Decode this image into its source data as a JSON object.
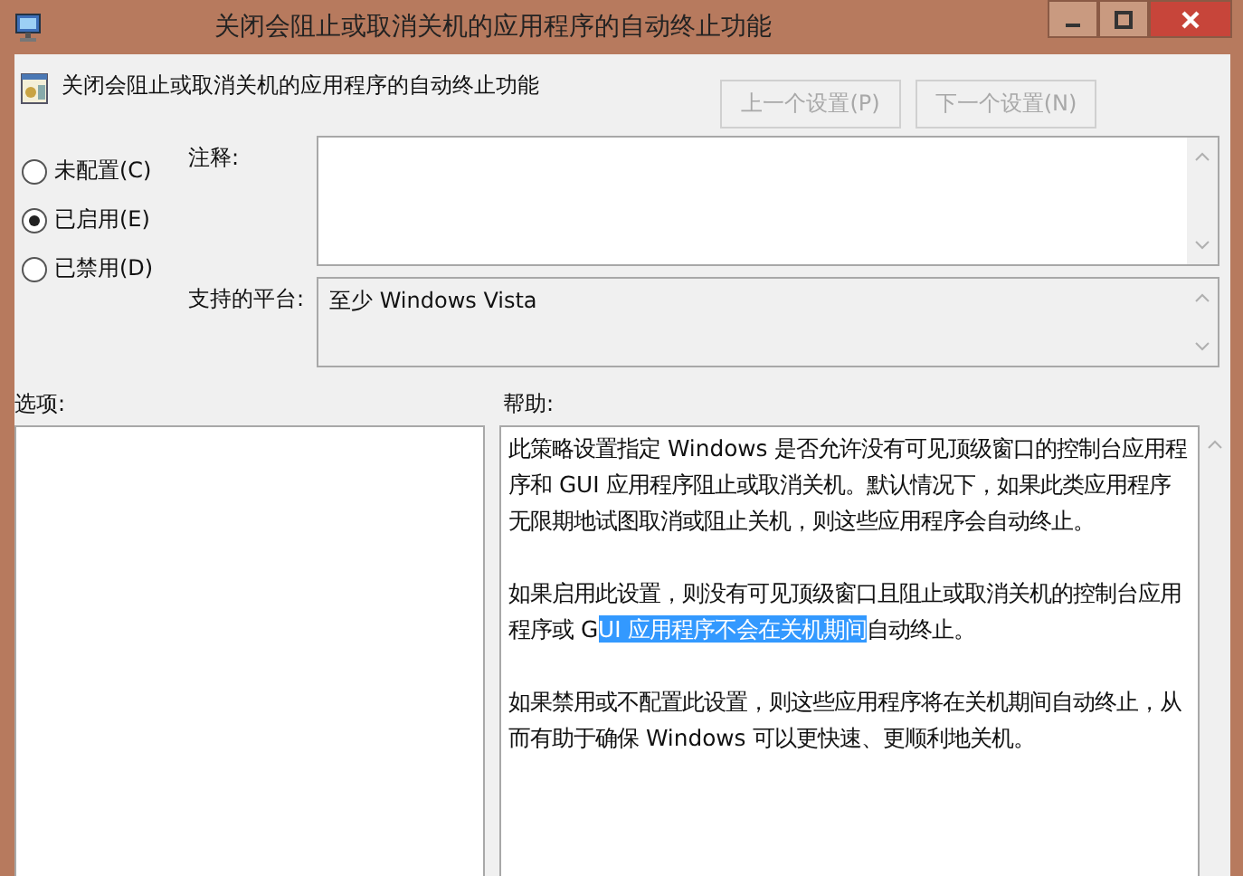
{
  "window": {
    "title": "关闭会阻止或取消关机的应用程序的自动终止功能"
  },
  "header": {
    "title": "关闭会阻止或取消关机的应用程序的自动终止功能"
  },
  "nav_buttons": [
    {
      "label": "上一个设置(P)",
      "disabled": true
    },
    {
      "label": "下一个设置(N)",
      "disabled": true
    }
  ],
  "state_options": [
    {
      "label": "未配置(C)",
      "selected": false
    },
    {
      "label": "已启用(E)",
      "selected": true
    },
    {
      "label": "已禁用(D)",
      "selected": false
    }
  ],
  "comment": {
    "label": "注释:"
  },
  "supported_on": {
    "label": "支持的平台:",
    "value": "至少 Windows Vista"
  },
  "options": {
    "label": "选项:"
  },
  "help": {
    "label": "帮助:",
    "paragraphs": [
      [
        {
          "text": "此策略设置指定 Windows 是否允许没有可见顶级窗口的控制台应用程序和 GUI 应用程序阻止或取消关机。默认情况下，如果此类应用程序无限期地试图取消或阻止关机，则这些应用程序会自动终止。",
          "selected": false
        }
      ],
      [
        {
          "text": "如果启用此设置，则没有可见顶级窗口且阻止或取消关机的控制台应用程序或 G",
          "selected": false
        },
        {
          "text": "UI 应用程序不会在关机期间",
          "selected": true
        },
        {
          "text": "自动终止。",
          "selected": false
        }
      ],
      [
        {
          "text": "如果禁用或不配置此设置，则这些应用程序将在关机期间自动终止，从而有助于确保 Windows 可以更快速、更顺利地关机。",
          "selected": false
        }
      ]
    ]
  }
}
